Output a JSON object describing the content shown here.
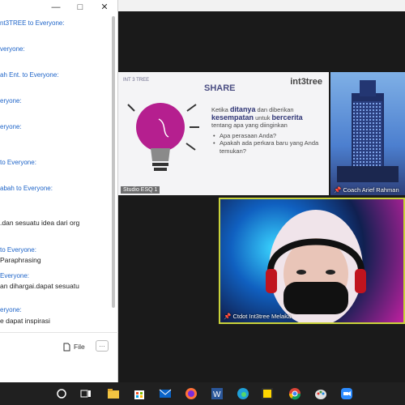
{
  "chat": {
    "messages": [
      {
        "header": "nt3TREE to Everyone:",
        "text": ""
      },
      {
        "header": "veryone:",
        "text": ""
      },
      {
        "header": "ah Ent. to Everyone:",
        "text": ""
      },
      {
        "header": "eryone:",
        "text": ""
      },
      {
        "header": "eryone:",
        "text": ""
      },
      {
        "header": "to Everyone:",
        "text": ""
      },
      {
        "header": "abah to Everyone:",
        "text": ""
      },
      {
        "header": "",
        "text": ".dan sesuatu idea dari org"
      },
      {
        "header": "to Everyone:",
        "text": "Paraphrasing"
      },
      {
        "header": "Everyone:",
        "text": "an dihargai.dapat sesuatu"
      },
      {
        "header": "eryone:",
        "text": "e dapat inspirasi"
      }
    ],
    "file_label": "File",
    "more_label": "…"
  },
  "slide": {
    "title": "SHARE",
    "logo_left": "INT 3 TREE",
    "logo_right": "int3tree",
    "line1_pre": "Ketika ",
    "line1_bold": "ditanya",
    "line1_post": " dan diberikan",
    "line2_bold": "kesempatan",
    "line2_mid": " untuk ",
    "line2_bold2": "bercerita",
    "line3": "tentang apa yang diinginkan",
    "bullet1": "Apa perasaan Anda?",
    "bullet2": "Apakah ada perkara baru yang Anda temukan?",
    "tile_label": "Studio ESQ 1"
  },
  "tiles": {
    "building_label": "Coach Arief Rahman",
    "speaker_label": "Ctdot Int3tree Melaka"
  },
  "colors": {
    "active_speaker_border": "#c9d23a",
    "chat_header": "#1e64c8"
  }
}
